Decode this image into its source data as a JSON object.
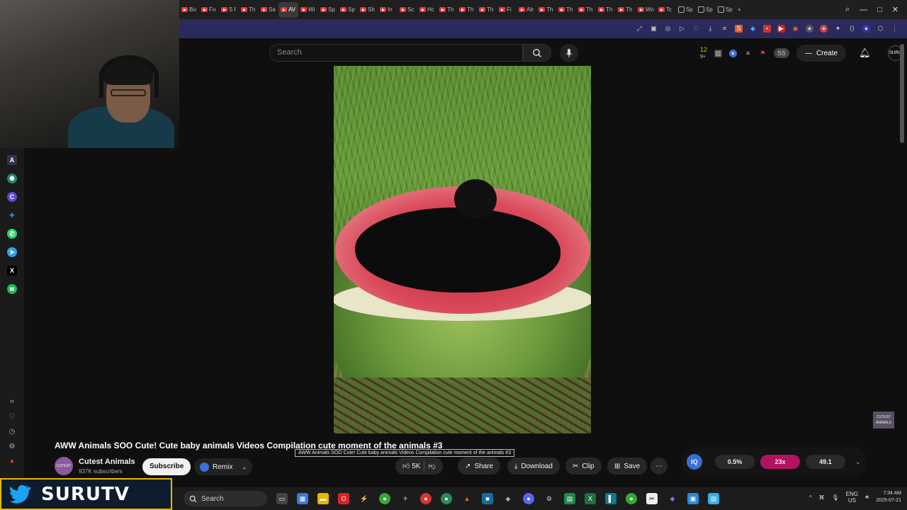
{
  "browser": {
    "tabs": [
      "Bu",
      "Fo",
      "S f",
      "Th",
      "Sa",
      "AV",
      "Wi",
      "Sp",
      "Sp",
      "Sh",
      "In",
      "Sc",
      "Hc",
      "Th",
      "Th",
      "Th",
      "Fi",
      "Ab",
      "Th",
      "Th",
      "Th",
      "Th",
      "Th",
      "Wo",
      "Tc",
      "Sp",
      "Sp",
      "Sp"
    ],
    "active_tab": "AV"
  },
  "masthead": {
    "search_placeholder": "Search",
    "notif_count": "12",
    "notif_sub": "9+",
    "badge": "SS",
    "create_label": "Create",
    "avatar_text": "SURU"
  },
  "video": {
    "title": "AWW Animals SOO Cute! Cute baby animals Videos Compilation cute moment of the animals #3",
    "tooltip": "AWW Animals SOO Cute! Cute baby animals Videos Compilation cute moment of the animals #3",
    "watermark": "CUTEST ANIMALS"
  },
  "channel": {
    "avatar_text": "CUTEST ANIMALS",
    "name": "Cutest Animals",
    "subscribers": "937K subscribers",
    "subscribe_label": "Subscribe",
    "remix_label": "Remix"
  },
  "actions": {
    "likes": "5K",
    "share": "Share",
    "download": "Download",
    "clip": "Clip",
    "save": "Save"
  },
  "stats": {
    "iq": "IQ",
    "percent": "0.5%",
    "multiplier": "23x",
    "score": "49.1"
  },
  "stream": {
    "brand": "SURUTV"
  },
  "taskbar": {
    "search_label": "Search",
    "lang": "ENG",
    "region": "US",
    "time": "7:34 AM",
    "date": "2025-07-21"
  }
}
